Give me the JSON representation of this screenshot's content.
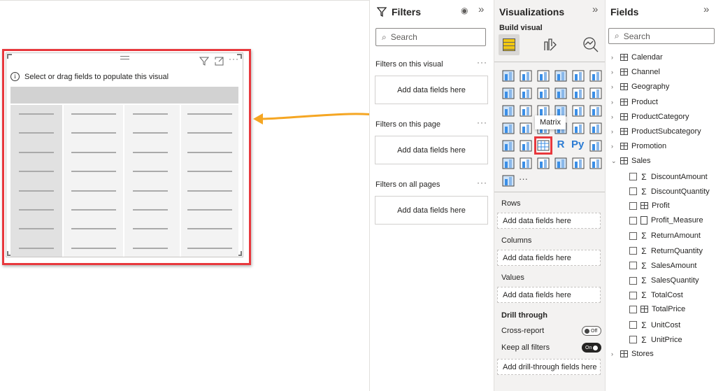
{
  "visual": {
    "hint": "Select or drag fields to populate this visual",
    "matrix_rows": 8,
    "matrix_cols": 4
  },
  "filters": {
    "title": "Filters",
    "search_placeholder": "Search",
    "sections": [
      {
        "label": "Filters on this visual",
        "box": "Add data fields here"
      },
      {
        "label": "Filters on this page",
        "box": "Add data fields here"
      },
      {
        "label": "Filters on all pages",
        "box": "Add data fields here"
      }
    ]
  },
  "viz": {
    "title": "Visualizations",
    "build_label": "Build visual",
    "tooltip": "Matrix",
    "icons": [
      "stacked-bar-chart",
      "stacked-column-chart",
      "clustered-bar-chart",
      "clustered-column-chart",
      "100-stacked-bar-chart",
      "100-stacked-column-chart",
      "line-chart",
      "area-chart",
      "stacked-area-chart",
      "line-clustered-column-chart",
      "line-stacked-column-chart",
      "ribbon-chart",
      "waterfall-chart",
      "funnel-chart",
      "scatter-chart",
      "pie-chart",
      "donut-chart",
      "treemap",
      "map",
      "filled-map",
      "shape-map",
      "card",
      "multi-row-card",
      "kpi",
      "slicer",
      "table",
      "matrix",
      "r-visual",
      "python-visual",
      "key-influencers",
      "decomposition-tree",
      "qa",
      "smart-narrative",
      "paginated-report",
      "arcgis-map",
      "power-apps",
      "power-automate",
      "more"
    ],
    "selected_index": 26,
    "wells": [
      {
        "label": "Rows",
        "box": "Add data fields here"
      },
      {
        "label": "Columns",
        "box": "Add data fields here"
      },
      {
        "label": "Values",
        "box": "Add data fields here"
      }
    ],
    "drill": {
      "title": "Drill through",
      "cross_report": "Cross-report",
      "cross_state": "Off",
      "keep": "Keep all filters",
      "keep_state": "On",
      "box": "Add drill-through fields here"
    },
    "accent": "#f2c811"
  },
  "fields": {
    "title": "Fields",
    "search_placeholder": "Search",
    "tables": [
      "Calendar",
      "Channel",
      "Geography",
      "Product",
      "ProductCategory",
      "ProductSubcategory",
      "Promotion",
      "Sales"
    ],
    "sales_fields": [
      {
        "name": "DiscountAmount",
        "type": "sum"
      },
      {
        "name": "DiscountQuantity",
        "type": "sum"
      },
      {
        "name": "Profit",
        "type": "calc"
      },
      {
        "name": "Profit_Measure",
        "type": "measure"
      },
      {
        "name": "ReturnAmount",
        "type": "sum"
      },
      {
        "name": "ReturnQuantity",
        "type": "sum"
      },
      {
        "name": "SalesAmount",
        "type": "sum"
      },
      {
        "name": "SalesQuantity",
        "type": "sum"
      },
      {
        "name": "TotalCost",
        "type": "sum"
      },
      {
        "name": "TotalPrice",
        "type": "calc"
      },
      {
        "name": "UnitCost",
        "type": "sum"
      },
      {
        "name": "UnitPrice",
        "type": "sum"
      }
    ],
    "last_table": "Stores"
  },
  "arrow_color": "#f5a623"
}
